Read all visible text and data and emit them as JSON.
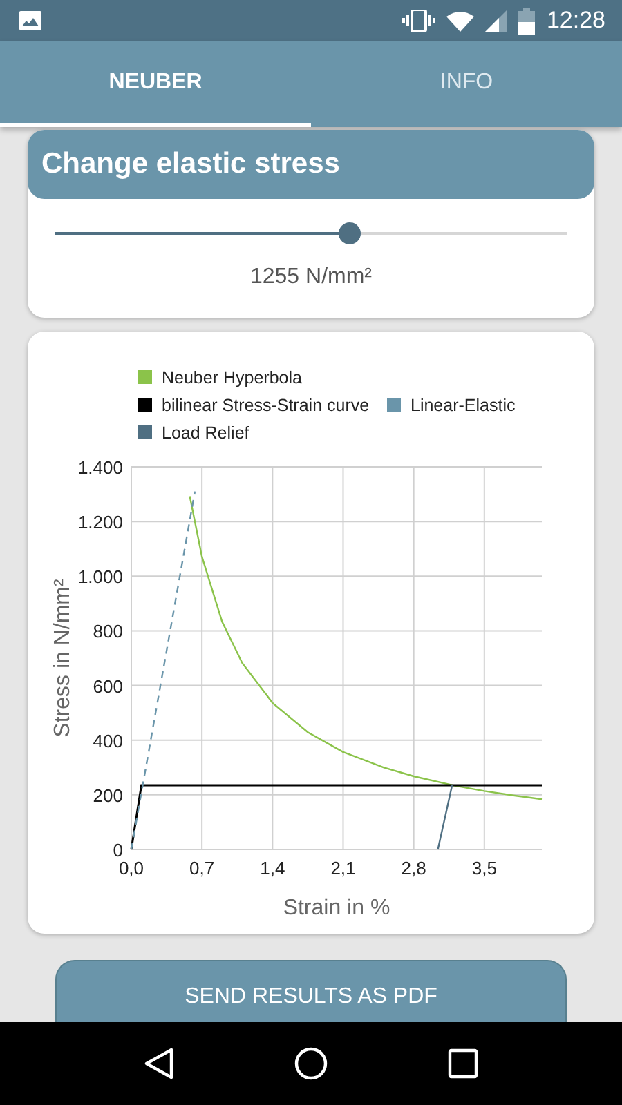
{
  "status_bar": {
    "time": "12:28"
  },
  "tabs": [
    {
      "label": "NEUBER",
      "selected": true
    },
    {
      "label": "INFO",
      "selected": false
    }
  ],
  "stress_card": {
    "title": "Change elastic stress",
    "slider": {
      "level": 0.576
    },
    "reading": "1255 N/mm²"
  },
  "chart_card": {
    "chart_data": {
      "type": "line",
      "grid": true,
      "legend": true,
      "xlabel": "Strain in %",
      "ylabel": "Stress in N/mm²",
      "xlim": [
        0,
        4.07
      ],
      "ylim": [
        0,
        1400
      ],
      "xticks": [
        {
          "value": 0,
          "label": "0,0"
        },
        {
          "value": 0.7,
          "label": "0,7"
        },
        {
          "value": 1.4,
          "label": "1,4"
        },
        {
          "value": 2.1,
          "label": "2,1"
        },
        {
          "value": 2.8,
          "label": "2,8"
        },
        {
          "value": 3.5,
          "label": "3,5"
        }
      ],
      "yticks": [
        {
          "value": 0,
          "label": "0"
        },
        {
          "value": 200,
          "label": "200"
        },
        {
          "value": 400,
          "label": "400"
        },
        {
          "value": 600,
          "label": "600"
        },
        {
          "value": 800,
          "label": "800"
        },
        {
          "value": 1000,
          "label": "1.000"
        },
        {
          "value": 1200,
          "label": "1.200"
        },
        {
          "value": 1400,
          "label": "1.400"
        }
      ],
      "series": [
        {
          "name": "Neuber Hyperbola",
          "color": "#8bc34a",
          "x": [
            0.58,
            0.7,
            0.9,
            1.1,
            1.4,
            1.75,
            2.1,
            2.5,
            2.8,
            3.2,
            3.5,
            3.8,
            4.07
          ],
          "values": [
            1293,
            1071,
            833,
            682,
            536,
            429,
            357,
            300,
            268,
            234,
            214,
            197,
            184
          ]
        },
        {
          "name": "bilinear Stress-Strain curve",
          "color": "#000000",
          "x": [
            0,
            0.1,
            4.07
          ],
          "values": [
            0,
            235,
            235
          ]
        },
        {
          "name": "Linear-Elastic",
          "color": "#6a95aa",
          "line_style": "dashed",
          "x": [
            0,
            0.63
          ],
          "values": [
            0,
            1310
          ]
        },
        {
          "name": "Load Relief",
          "color": "#4f6f82",
          "x": [
            3.04,
            3.18
          ],
          "values": [
            0,
            235
          ]
        }
      ]
    }
  },
  "send_button": {
    "label": "SEND RESULTS AS PDF"
  }
}
